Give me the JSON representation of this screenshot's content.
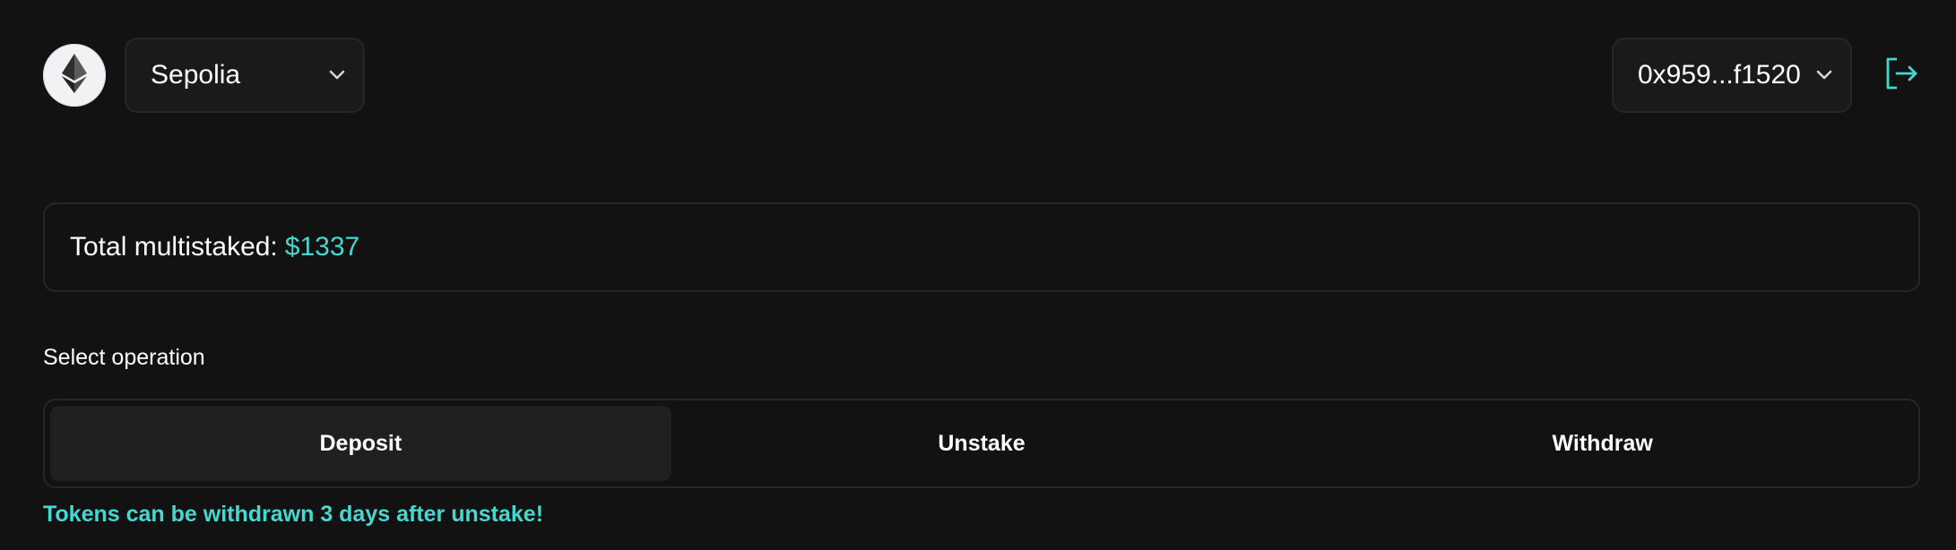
{
  "theme": {
    "background": "#121212",
    "accent": "#45d8d1",
    "border": "#262626",
    "active_tab": "#202020"
  },
  "header": {
    "chain_logo_icon": "ethereum-icon",
    "network": {
      "selected": "Sepolia",
      "icon": "chevron-down-icon"
    },
    "account": {
      "address": "0x959...f1520",
      "icon": "chevron-down-icon"
    },
    "logout_icon": "logout-icon"
  },
  "summary": {
    "label": "Total multistaked:",
    "value": "$1337"
  },
  "operation": {
    "label": "Select operation",
    "tabs": [
      {
        "label": "Deposit",
        "active": true
      },
      {
        "label": "Unstake",
        "active": false
      },
      {
        "label": "Withdraw",
        "active": false
      }
    ]
  },
  "notice": {
    "text": "Tokens can be withdrawn 3 days after unstake!"
  }
}
